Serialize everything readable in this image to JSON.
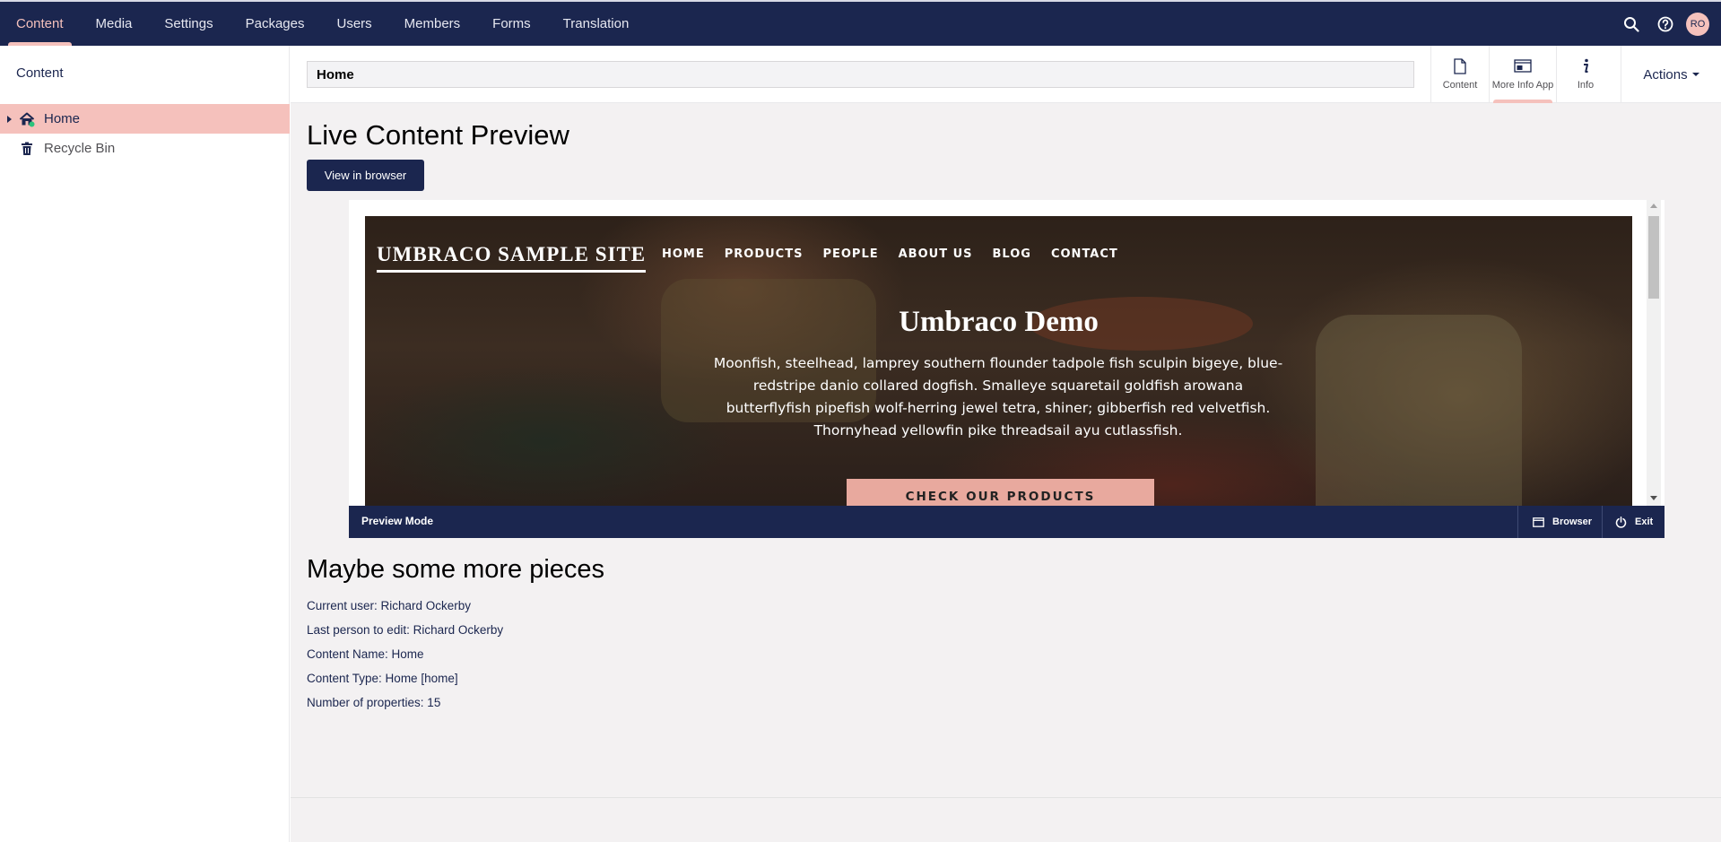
{
  "topnav": {
    "items": [
      {
        "label": "Content",
        "active": true
      },
      {
        "label": "Media"
      },
      {
        "label": "Settings"
      },
      {
        "label": "Packages"
      },
      {
        "label": "Users"
      },
      {
        "label": "Members"
      },
      {
        "label": "Forms"
      },
      {
        "label": "Translation"
      }
    ],
    "icons": [
      "search-icon",
      "help-icon"
    ],
    "avatar_initials": "RO"
  },
  "sidebar": {
    "title": "Content",
    "tree": [
      {
        "label": "Home",
        "icon": "home-icon",
        "selected": true
      },
      {
        "label": "Recycle Bin",
        "icon": "trash-icon"
      }
    ]
  },
  "editor": {
    "node_name": "Home",
    "apps": [
      {
        "label": "Content",
        "icon": "document-icon"
      },
      {
        "label": "More Info App",
        "icon": "window-icon",
        "active": true
      },
      {
        "label": "Info",
        "icon": "info-icon"
      }
    ],
    "actions_label": "Actions"
  },
  "preview": {
    "heading": "Live Content Preview",
    "view_button": "View in browser",
    "site": {
      "logo": "UMBRACO SAMPLE SITE",
      "nav": [
        "HOME",
        "PRODUCTS",
        "PEOPLE",
        "ABOUT US",
        "BLOG",
        "CONTACT"
      ],
      "hero_title": "Umbraco Demo",
      "hero_text": "Moonfish, steelhead, lamprey southern flounder tadpole fish sculpin bigeye, blue-redstripe danio collared dogfish. Smalleye squaretail goldfish arowana butterflyfish pipefish wolf-herring jewel tetra, shiner; gibberfish red velvetfish. Thornyhead yellowfin pike threadsail ayu cutlassfish.",
      "cta": "CHECK OUR PRODUCTS"
    },
    "bar": {
      "mode_label": "Preview Mode",
      "browser_label": "Browser",
      "exit_label": "Exit"
    }
  },
  "more": {
    "heading": "Maybe some more pieces",
    "lines": [
      "Current user: Richard Ockerby",
      "Last person to edit: Richard Ockerby",
      "Content Name: Home",
      "Content Type: Home [home]",
      "Number of properties: 15"
    ]
  },
  "colors": {
    "header_bg": "#1b264f",
    "accent": "#f5c1bc",
    "cta_bg": "#e8a99e"
  }
}
